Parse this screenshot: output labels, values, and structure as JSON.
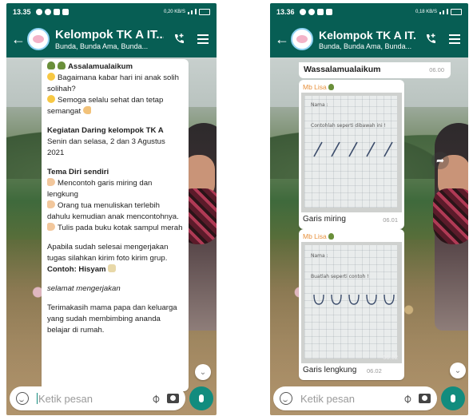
{
  "screen1": {
    "status_time": "13.35",
    "status_net": "0,20 KB/S",
    "group_title": "Kelompok TK A IT...",
    "group_subtitle": "Bunda, Bunda Ama, Bunda...",
    "message": {
      "l1": "Assalamualaikum",
      "l2": "Bagaimana kabar hari ini anak solih solihah?",
      "l3": "Semoga selalu sehat dan tetap semangat",
      "l4": "Kegiatan Daring kelompok TK A",
      "l5": "Senin dan selasa, 2 dan 3 Agustus 2021",
      "l6": "Tema Diri sendiri",
      "l7": "Mencontoh garis miring dan lengkung",
      "l8": "Orang tua menuliskan terlebih dahulu kemudian anak mencontohnya.",
      "l9": "Tulis pada buku kotak sampul merah",
      "l10": "Apabila sudah selesai mengerjakan tugas silahkan kirim foto kirim grup.",
      "l11": "Contoh: Hisyam",
      "l12": "selamat mengerjakan",
      "l13": "Terimakasih mama papa dan keluarga yang sudah membimbing ananda belajar di rumah."
    },
    "input_placeholder": "Ketik pesan"
  },
  "screen2": {
    "status_time": "13.36",
    "status_net": "0,18 KB/S",
    "group_title": "Kelompok TK A IT...",
    "group_subtitle": "Bunda, Bunda Ama, Bunda...",
    "prev_message": "Wassalamualaikum",
    "prev_time": "06.00",
    "image1": {
      "sender": "Mb Lisa",
      "paper_name": "Nama :",
      "paper_instruction": "Contohlah seperti dibawah ini !",
      "caption": "Garis miring",
      "time": "06.01"
    },
    "image2": {
      "sender": "Mb Lisa",
      "paper_name": "Nama :",
      "paper_instruction": "Buatlah seperti contoh !",
      "photo_time": "06.02",
      "caption": "Garis lengkung",
      "time": "06.02"
    },
    "input_placeholder": "Ketik pesan"
  },
  "colors": {
    "header": "#075e54",
    "accent": "#128c7e",
    "sender": "#e7903c"
  },
  "icons": [
    "back-arrow-icon",
    "call-add-icon",
    "menu-icon",
    "emoji-icon",
    "attach-icon",
    "camera-icon",
    "mic-icon",
    "scroll-down-icon",
    "share-icon"
  ]
}
